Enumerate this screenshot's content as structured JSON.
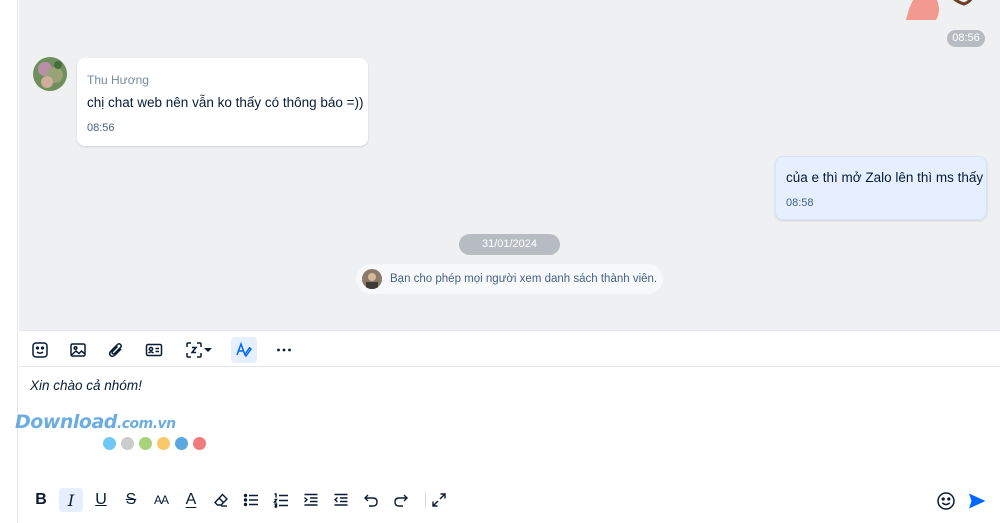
{
  "messages": [
    {
      "time_pill": "08:56"
    },
    {
      "sender": "Thu Hương",
      "text": "chị chat web nên vẫn ko thấy có thông báo =))",
      "time": "08:56"
    },
    {
      "text": "của e thì mở Zalo lên thì ms thấy",
      "time": "08:58"
    }
  ],
  "date_divider": "31/01/2024",
  "system_note": "Bạn cho phép mọi người xem danh sách thành viên.",
  "toolbar": {
    "icons": [
      "sticker-icon",
      "image-icon",
      "attachment-icon",
      "contact-card-icon",
      "screenshot-icon",
      "format-text-icon",
      "more-icon"
    ],
    "active": "format-text-icon"
  },
  "composer": {
    "text": "Xin chào cả nhóm!"
  },
  "watermark": {
    "brand": "Download",
    "suffix": ".com.vn",
    "dot_colors": [
      "#71c7f4",
      "#cccccc",
      "#a8d37a",
      "#f7c96a",
      "#5aa8df",
      "#ef7b7b"
    ]
  },
  "format_bar": {
    "bold": "B",
    "italic": "I",
    "underline": "U",
    "strike": "S",
    "font_size": "AA",
    "font_color": "A",
    "active": "italic"
  },
  "colors": {
    "accent": "#0068ff",
    "outgoing_bubble": "#e5efff",
    "chat_bg": "#eef0f1"
  }
}
